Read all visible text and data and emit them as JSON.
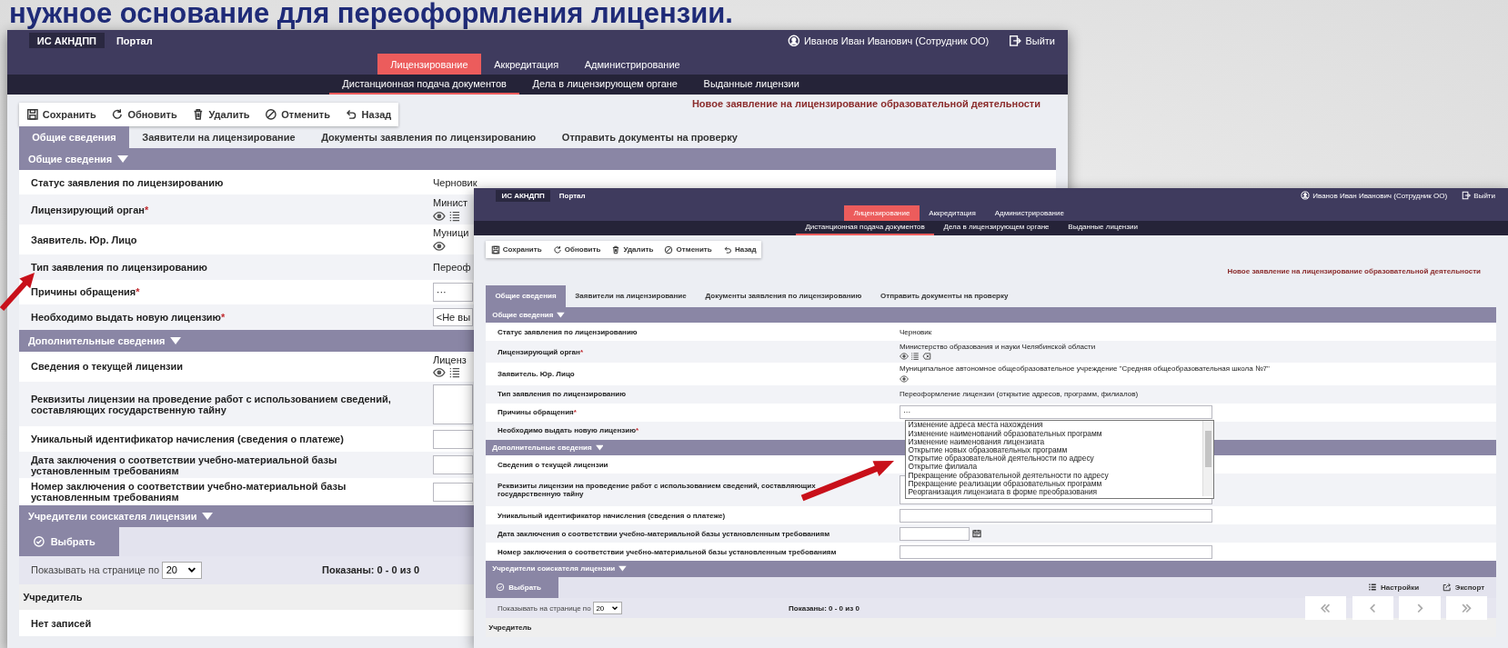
{
  "slide_title": "нужное основание для переоформления лицензии.",
  "back_screenshot": {
    "header": {
      "brand": "ИС АКНДПП",
      "portal": "Портал",
      "user": "Иванов Иван Иванович (Сотрудник ОО)",
      "logout": "Выйти"
    },
    "nav": [
      {
        "label": "Лицензирование",
        "selected": true
      },
      {
        "label": "Аккредитация",
        "selected": false
      },
      {
        "label": "Администрирование",
        "selected": false
      }
    ],
    "subnav": [
      {
        "label": "Дистанционная подача документов",
        "selected": true
      },
      {
        "label": "Дела в лицензирующем органе",
        "selected": false
      },
      {
        "label": "Выданные лицензии",
        "selected": false
      }
    ],
    "toolbar": [
      {
        "label": "Сохранить",
        "kind": "save"
      },
      {
        "label": "Обновить",
        "kind": "refresh"
      },
      {
        "label": "Удалить",
        "kind": "delete"
      },
      {
        "label": "Отменить",
        "kind": "cancel"
      },
      {
        "label": "Назад",
        "kind": "back"
      }
    ],
    "page_title": "Новое заявление на лицензирование образовательной деятельности",
    "form_tabs": [
      {
        "label": "Общие сведения",
        "selected": true
      },
      {
        "label": "Заявители на лицензирование",
        "selected": false
      },
      {
        "label": "Документы заявления по лицензированию",
        "selected": false
      },
      {
        "label": "Отправить документы на проверку",
        "selected": false
      }
    ],
    "sections": [
      {
        "title": "Общие сведения",
        "expanded": true,
        "rows": [
          {
            "label": "Статус заявления по лицензированию",
            "kind": "text",
            "value": "Черновик"
          },
          {
            "label": "Лицензирующий орган",
            "required_mark": "*",
            "kind": "lookup",
            "value": "Минист",
            "buttons": [
              {
                "kind": "view"
              },
              {
                "kind": "list"
              }
            ]
          },
          {
            "label": "Заявитель. Юр. Лицо",
            "kind": "lookup",
            "value": "Муници",
            "buttons": [
              {
                "kind": "view"
              }
            ]
          },
          {
            "label": "Тип заявления по лицензированию",
            "kind": "text",
            "value": "Переоф"
          },
          {
            "label": "Причины обращения",
            "required_mark": "*",
            "kind": "input",
            "value": "···"
          },
          {
            "label": "Необходимо выдать новую лицензию",
            "required_mark": "*",
            "kind": "input",
            "value": "<Не вы"
          }
        ]
      },
      {
        "title": "Дополнительные сведения",
        "expanded": true,
        "rows": [
          {
            "label": "Сведения о текущей лицензии",
            "kind": "lookup",
            "value": "Лиценз",
            "buttons": [
              {
                "kind": "view"
              },
              {
                "kind": "list"
              }
            ]
          },
          {
            "label": "Реквизиты лицензии на проведение работ с использованием сведений, составляющих государственную тайну",
            "kind": "textarea"
          },
          {
            "label": "Уникальный идентификатор начисления (сведения о платеже)",
            "kind": "input"
          },
          {
            "label": "Дата заключения о соответствии учебно-материальной базы установленным требованиям",
            "kind": "input"
          },
          {
            "label": "Номер заключения о соответствии учебно-материальной базы установленным требованиям",
            "kind": "input"
          }
        ]
      }
    ],
    "founders": {
      "title": "Учредители соискателя лицензии",
      "expanded": true,
      "select_button": "Выбрать",
      "page_size_label": "Показывать на странице по",
      "page_size": "20",
      "shown": "Показаны: 0 - 0 из 0",
      "column": "Учредитель",
      "empty": "Нет записей"
    }
  },
  "front_screenshot": {
    "header": {
      "brand": "ИС АКНДПП",
      "portal": "Портал",
      "user": "Иванов Иван Иванович (Сотрудник ОО)",
      "logout": "Выйти"
    },
    "nav": [
      {
        "label": "Лицензирование",
        "selected": true
      },
      {
        "label": "Аккредитация",
        "selected": false
      },
      {
        "label": "Администрирование",
        "selected": false
      }
    ],
    "subnav": [
      {
        "label": "Дистанционная подача документов",
        "selected": true
      },
      {
        "label": "Дела в лицензирующем органе",
        "selected": false
      },
      {
        "label": "Выданные лицензии",
        "selected": false
      }
    ],
    "toolbar": [
      {
        "label": "Сохранить",
        "kind": "save"
      },
      {
        "label": "Обновить",
        "kind": "refresh"
      },
      {
        "label": "Удалить",
        "kind": "delete"
      },
      {
        "label": "Отменить",
        "kind": "cancel"
      },
      {
        "label": "Назад",
        "kind": "back"
      }
    ],
    "page_title": "Новое заявление на лицензирование образовательной деятельности",
    "form_tabs": [
      {
        "label": "Общие сведения",
        "selected": true
      },
      {
        "label": "Заявители на лицензирование",
        "selected": false
      },
      {
        "label": "Документы заявления по лицензированию",
        "selected": false
      },
      {
        "label": "Отправить документы на проверку",
        "selected": false
      }
    ],
    "sections": [
      {
        "title": "Общие сведения",
        "expanded": true,
        "rows": [
          {
            "label": "Статус заявления по лицензированию",
            "kind": "text",
            "value": "Черновик"
          },
          {
            "label": "Лицензирующий орган",
            "required_mark": "*",
            "kind": "lookup",
            "value": "Министерство образования и науки Челябинской области",
            "buttons": [
              {
                "kind": "view"
              },
              {
                "kind": "list"
              },
              {
                "kind": "clear"
              }
            ]
          },
          {
            "label": "Заявитель. Юр. Лицо",
            "kind": "lookup",
            "value": "Муниципальное автономное общеобразовательное учреждение \"Средняя общеобразовательная школа №7\"",
            "buttons": [
              {
                "kind": "view"
              }
            ]
          },
          {
            "label": "Тип заявления по лицензированию",
            "kind": "text",
            "value": "Переоформление лицензии (открытие адресов, программ, филиалов)"
          },
          {
            "label": "Причины обращения",
            "required_mark": "*",
            "kind": "input",
            "value": "···",
            "options": [
              "Изменение адреса места нахождения",
              "Изменение наименований образовательных программ",
              "Изменение наименования лицензиата",
              "Открытие новых образовательных программ",
              "Открытие образовательной деятельности по адресу",
              "Открытие филиала",
              "Прекращение образовательной деятельности по адресу",
              "Прекращение реализации образовательных программ",
              "Реорганизация лицензиата в форме преобразования"
            ]
          },
          {
            "label": "Необходимо выдать новую лицензию",
            "required_mark": "*",
            "kind": "none"
          }
        ]
      },
      {
        "title": "Дополнительные сведения",
        "expanded": true,
        "rows": [
          {
            "label": "Сведения о текущей лицензии",
            "kind": "none"
          },
          {
            "label": "Реквизиты лицензии на проведение работ с использованием сведений, составляющих государственную тайну",
            "kind": "textarea"
          },
          {
            "label": "Уникальный идентификатор начисления (сведения о платеже)",
            "kind": "input"
          },
          {
            "label": "Дата заключения о соответствии учебно-материальной базы установленным требованиям",
            "kind": "date"
          },
          {
            "label": "Номер заключения о соответствии учебно-материальной базы установленным требованиям",
            "kind": "input"
          }
        ]
      }
    ],
    "founders": {
      "title": "Учредители соискателя лицензии",
      "expanded": true,
      "select_button": "Выбрать",
      "settings": "Настройки",
      "export": "Экспорт",
      "page_size_label": "Показывать на странице по",
      "page_size": "20",
      "shown": "Показаны: 0 - 0 из 0",
      "pager": [
        {
          "kind": "first"
        },
        {
          "kind": "prev"
        },
        {
          "kind": "next"
        },
        {
          "kind": "last"
        }
      ],
      "column": "Учредитель"
    }
  }
}
